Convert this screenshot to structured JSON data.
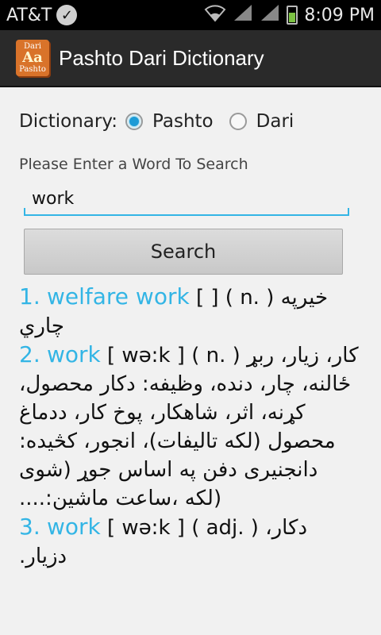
{
  "status_bar": {
    "carrier": "AT&T",
    "time": "8:09 PM"
  },
  "action_bar": {
    "title": "Pashto Dari Dictionary",
    "icon_text_top": "Dari",
    "icon_text_mid": "Aa",
    "icon_text_bottom": "Pashto"
  },
  "form": {
    "dictionary_label": "Dictionary:",
    "options": [
      {
        "label": "Pashto",
        "checked": true
      },
      {
        "label": "Dari",
        "checked": false
      }
    ],
    "hint": "Please Enter a Word To Search",
    "input_value": "work",
    "search_button": "Search"
  },
  "results": [
    {
      "num": "1.",
      "word": "welfare work",
      "pron": "[ ]",
      "pos": "( n. )",
      "translation": "خیرپه چاري"
    },
    {
      "num": "2.",
      "word": "work",
      "pron": "[ wə:k ]",
      "pos": "( n. )",
      "translation": "کار، زیار، ربړ ځالنه، چار، دنده، وظیفه: دکار محصول، کړنه، اثر، شاهکار، پوخ کار، ددماغ محصول (لکه تالیفات)، انجور، کڅیده: دانجنیری دفن په اساس جوړ (شوی (لکه ،ساعت ماشین:...."
    },
    {
      "num": "3.",
      "word": "work",
      "pron": "[ wə:k ]",
      "pos": "( adj. )",
      "translation": "دکار، دزیار."
    }
  ],
  "colors": {
    "accent": "#33b5e5",
    "action_bar": "#2a2a2a",
    "background": "#f1f1f1"
  }
}
